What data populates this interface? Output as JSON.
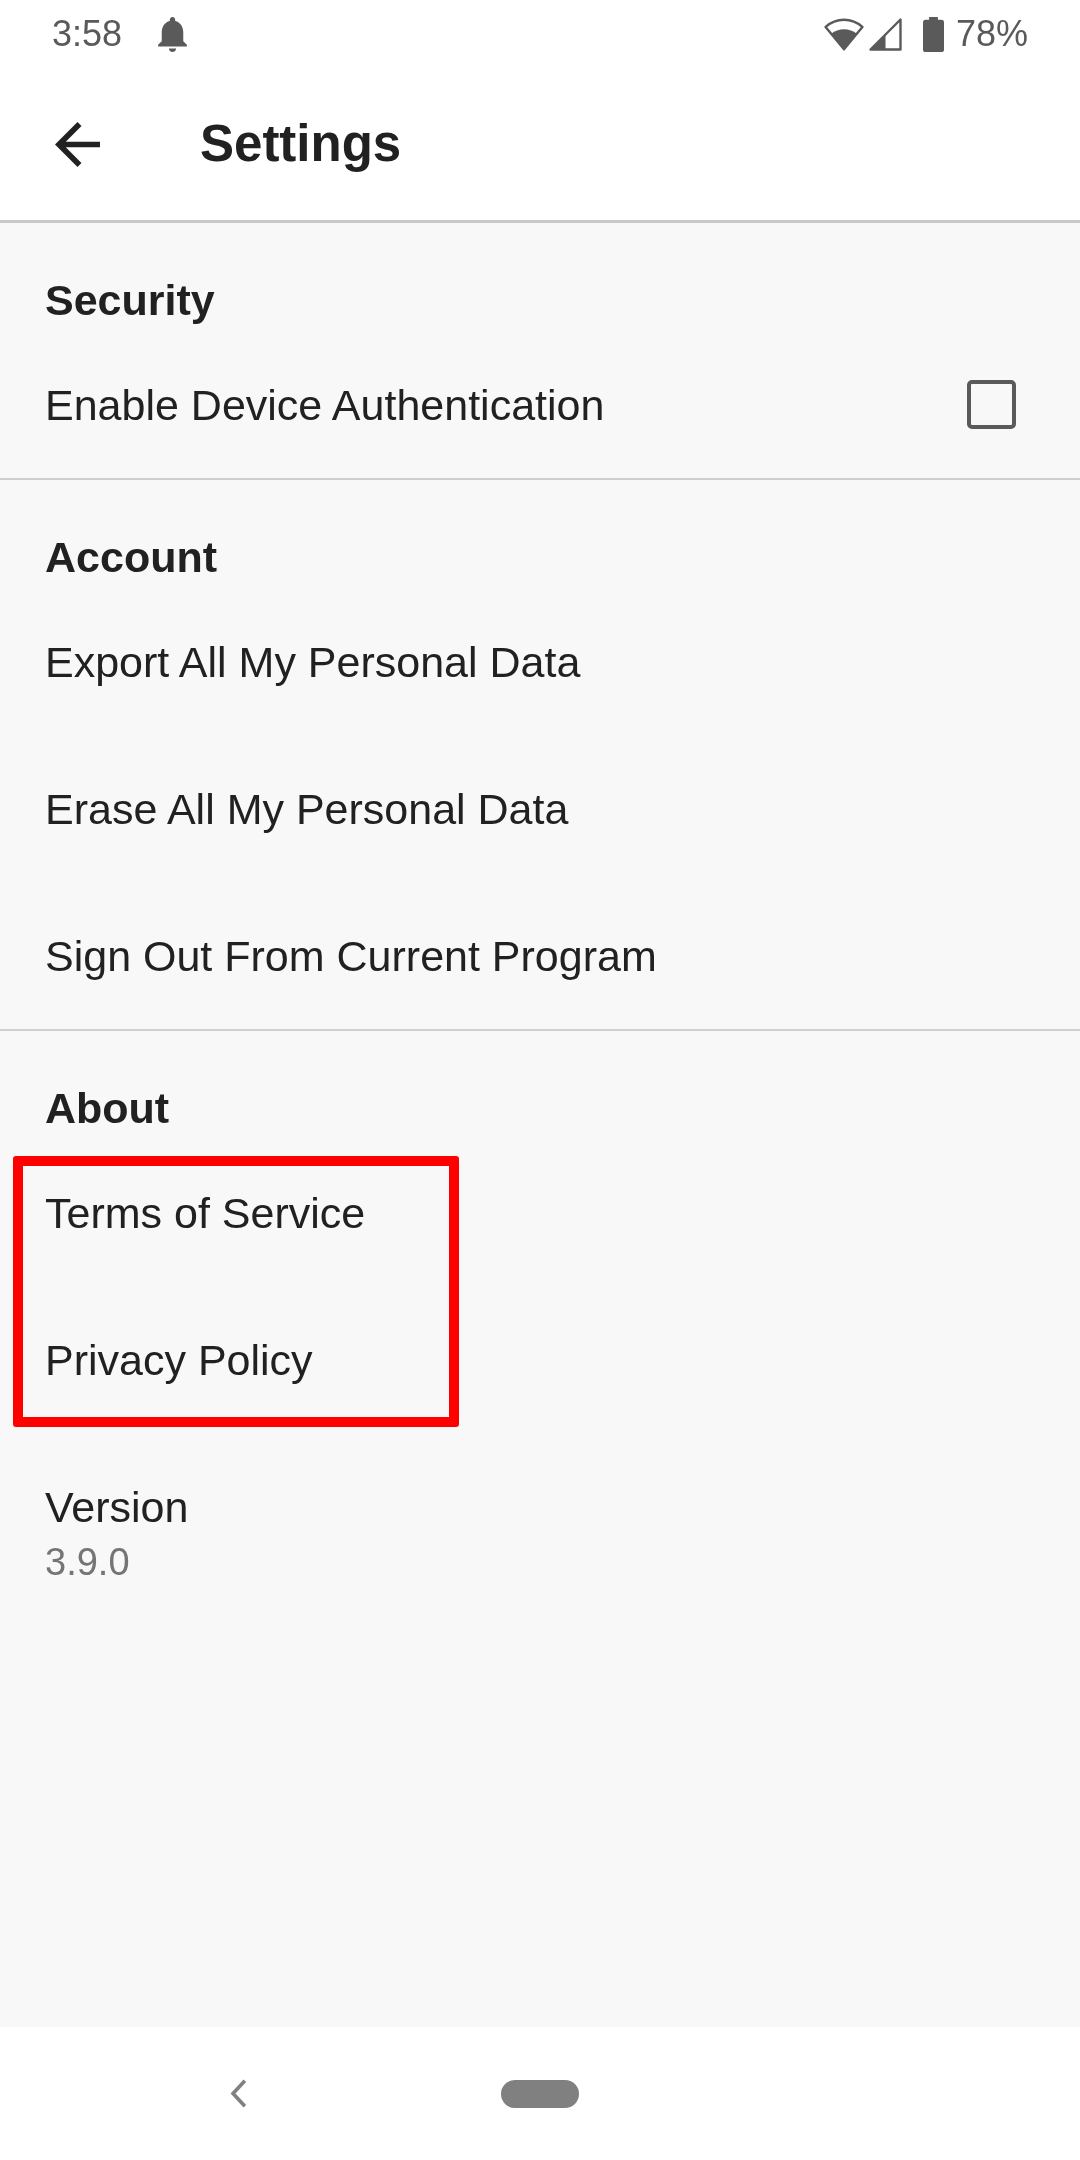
{
  "status_bar": {
    "time": "3:58",
    "battery": "78%"
  },
  "app_bar": {
    "title": "Settings"
  },
  "sections": [
    {
      "title": "Security",
      "items": [
        {
          "kind": "checkbox",
          "title": "Enable Device Authentication",
          "checked": false,
          "highlighted": false
        }
      ]
    },
    {
      "title": "Account",
      "items": [
        {
          "kind": "action",
          "title": "Export All My Personal Data",
          "highlighted": false
        },
        {
          "kind": "action",
          "title": "Erase All My Personal Data",
          "highlighted": false
        },
        {
          "kind": "action",
          "title": "Sign Out From Current Program",
          "highlighted": false
        }
      ]
    },
    {
      "title": "About",
      "items": [
        {
          "kind": "action",
          "title": "Terms of Service",
          "highlighted": true
        },
        {
          "kind": "action",
          "title": "Privacy Policy",
          "highlighted": true
        },
        {
          "kind": "info",
          "title": "Version",
          "summary": "3.9.0",
          "highlighted": false
        }
      ]
    }
  ]
}
